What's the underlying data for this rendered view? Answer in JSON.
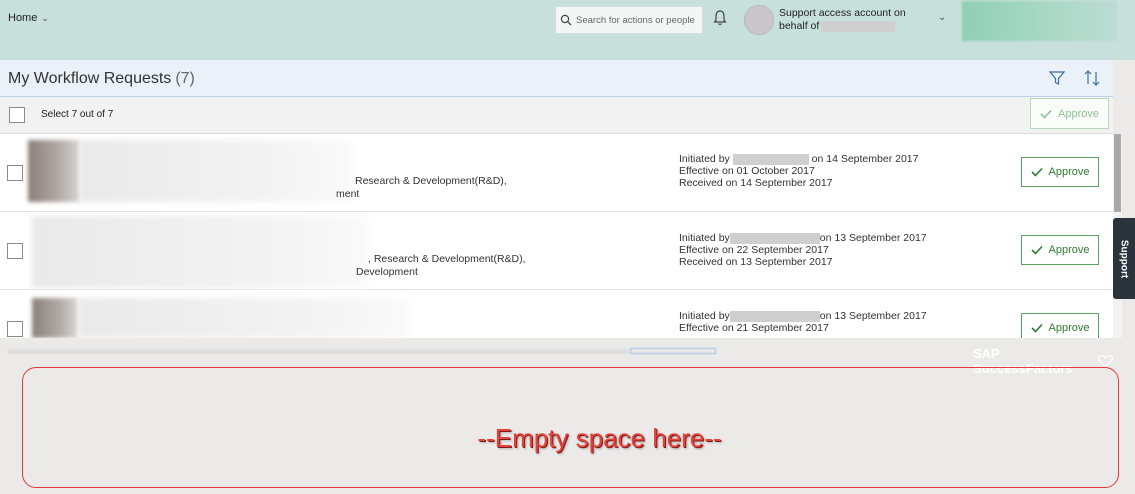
{
  "header": {
    "home_label": "Home",
    "search_placeholder": "Search for actions or people",
    "account_line1": "Support access account on",
    "account_line2": "behalf of"
  },
  "toolbar": {
    "title": "My Workflow Requests",
    "count": "(7)",
    "select_label": "Select 7 out of 7",
    "approve_all_label": "Approve"
  },
  "requests": [
    {
      "dept_line1": "Research & Development(R&D),",
      "dept_line2": "ment",
      "initiated_prefix": "Initiated by",
      "initiated_date": "on 14 September 2017",
      "effective": "Effective on 01 October 2017",
      "received": "Received on 14 September 2017",
      "approve_label": "Approve"
    },
    {
      "dept_line1": ", Research & Development(R&D),",
      "dept_line2": "Development",
      "initiated_prefix": "Initiated by",
      "initiated_date": "on 13 September 2017",
      "effective": "Effective on 22 September 2017",
      "received": "Received on 13 September 2017",
      "approve_label": "Approve"
    },
    {
      "dept_line1": "",
      "dept_line2": "",
      "initiated_prefix": "Initiated by",
      "initiated_date": "on 13 September 2017",
      "effective": "Effective on 21 September 2017",
      "received": "",
      "approve_label": "Approve"
    }
  ],
  "support_tab": "Support",
  "footer": {
    "brand": "SAP SuccessFactors"
  },
  "annotation": {
    "text": "--Empty space here--",
    "color": "#e8413a"
  },
  "colors": {
    "header_bg": "#c8e0db",
    "approve_green": "#2e7d32",
    "titlebar_bg": "#eaf1f8"
  },
  "icons": [
    "chevron-down-icon",
    "search-icon",
    "bell-icon",
    "filter-icon",
    "sort-icon",
    "check-icon",
    "heart-icon"
  ]
}
